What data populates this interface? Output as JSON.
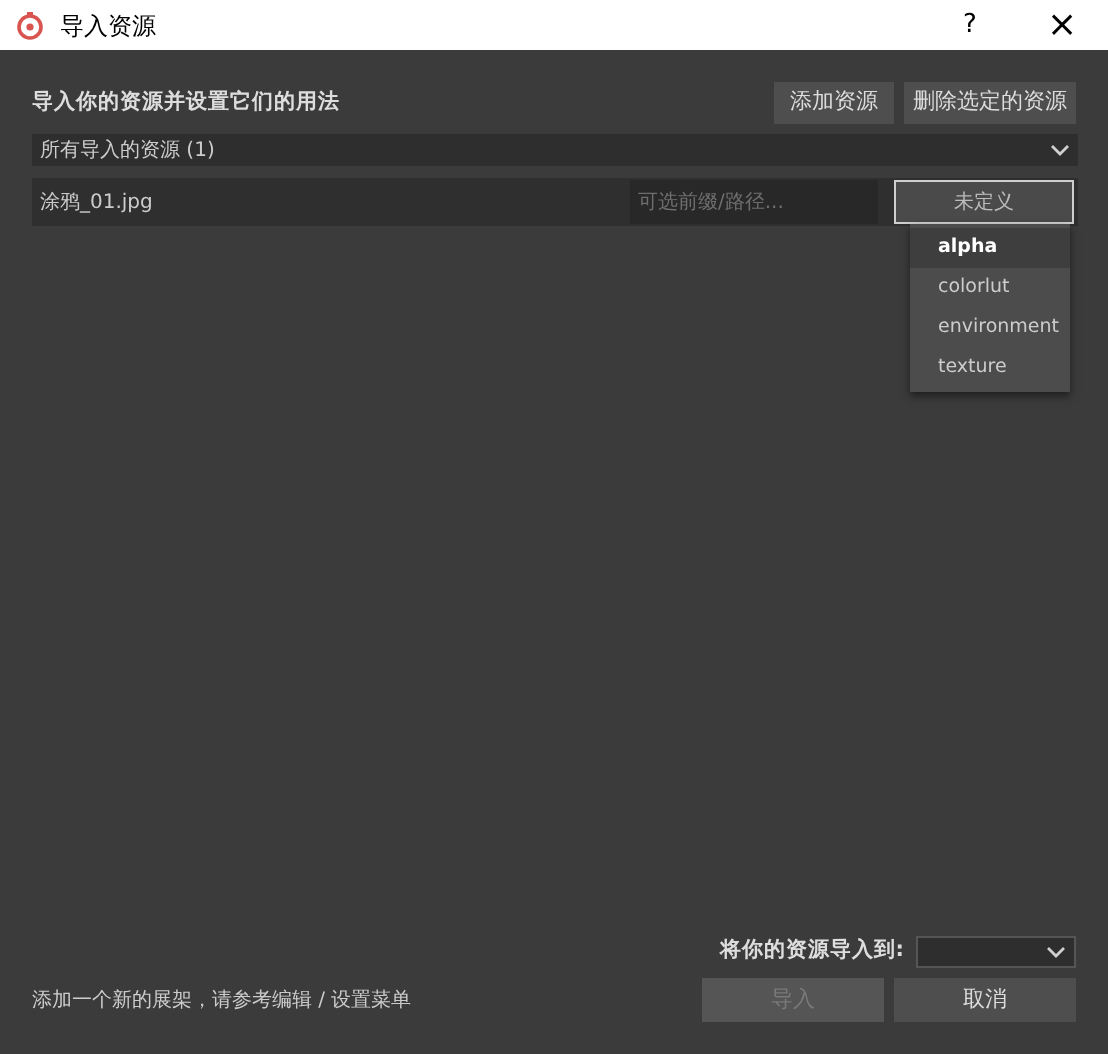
{
  "window": {
    "title": "导入资源",
    "help": "?",
    "close": "×"
  },
  "header": {
    "title": "导入你的资源并设置它们的用法",
    "buttons": [
      {
        "label": "添加资源",
        "disabled": false
      },
      {
        "label": "删除选定的资源",
        "disabled": false
      }
    ]
  },
  "filter": {
    "value": "所有导入的资源 (1)"
  },
  "assets": [
    {
      "name": "涂鸦_01.jpg",
      "placeholder": "可选前缀/路径...",
      "type": "未定义",
      "menu_open": true
    }
  ],
  "type_menu": [
    {
      "label": "alpha",
      "selected": true
    },
    {
      "label": "colorlut",
      "selected": false
    },
    {
      "label": "environment",
      "selected": false
    },
    {
      "label": "texture",
      "selected": false
    }
  ],
  "footer": {
    "hint": "添加一个新的展架，请参考编辑 / 设置菜单",
    "target_label": "将你的资源导入到:",
    "buttons": [
      {
        "label": "导入",
        "disabled": true
      },
      {
        "label": "取消",
        "disabled": false
      }
    ]
  }
}
